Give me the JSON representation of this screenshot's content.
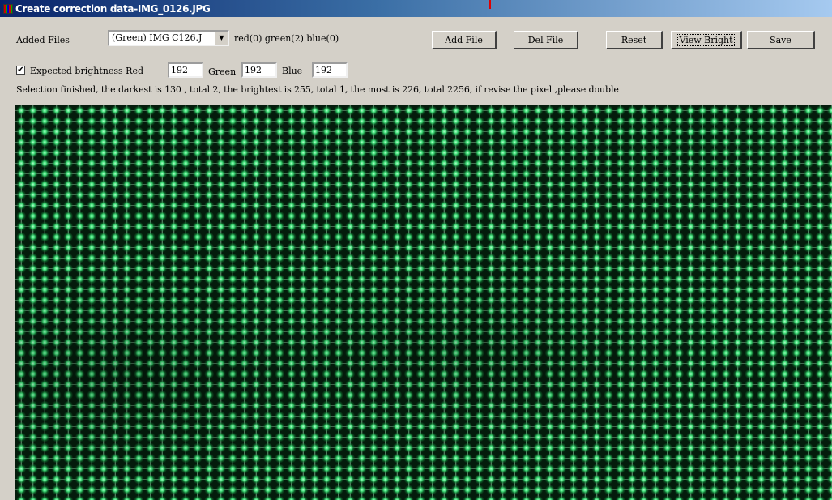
{
  "window": {
    "title": "Create correction data-IMG_0126.JPG"
  },
  "files": {
    "label": "Added Files",
    "selected": "(Green) IMG C126.J",
    "counts": "red(0) green(2) blue(0)"
  },
  "toolbar": {
    "add_file": "Add File",
    "del_file": "Del File",
    "reset": "Reset",
    "view_bright": "View Bright",
    "save": "Save"
  },
  "brightness": {
    "checkbox_label": "Expected brightness Red",
    "checked": true,
    "red_value": "192",
    "green_label": "Green",
    "green_value": "192",
    "blue_label": "Blue",
    "blue_value": "192"
  },
  "status": {
    "message": "Selection finished, the darkest is 130 , total 2, the brightest is 255, total 1, the most is 226, total 2256, if revise the pixel ,please double"
  },
  "icons": {
    "title_icon": "app-icon",
    "dropdown_icon": "chevron-down-icon",
    "check_icon": "checkmark-icon"
  },
  "colors": {
    "window_bg": "#d4d0c8",
    "title_start": "#0a246a",
    "title_end": "#a6caf0",
    "led_green": "#41e07a",
    "image_bg": "#041c0c"
  }
}
